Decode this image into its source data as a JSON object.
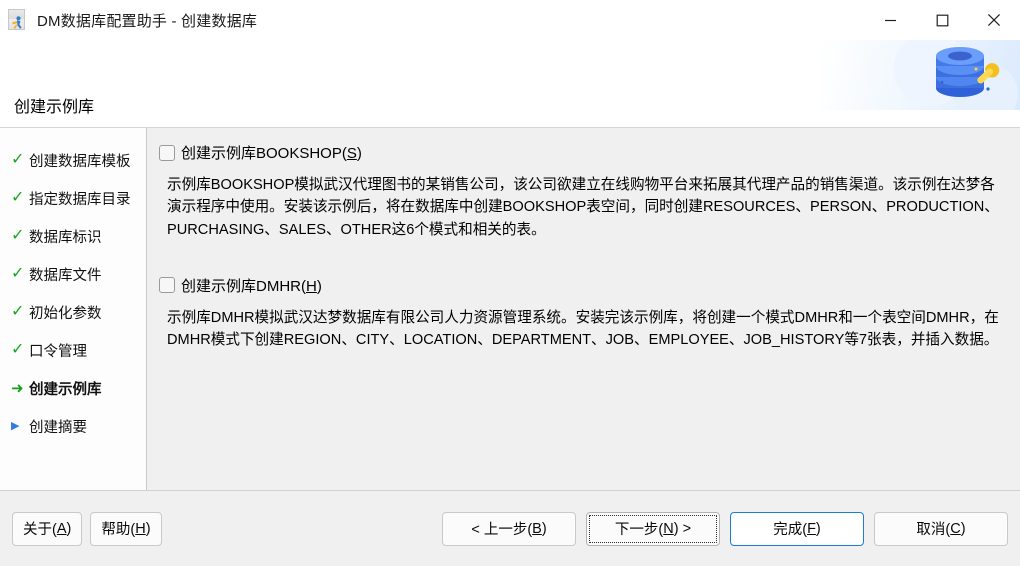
{
  "window": {
    "title": "DM数据库配置助手 - 创建数据库",
    "app_icon": "dm-assistant-icon",
    "controls": {
      "minimize": "minimize-icon",
      "maximize": "maximize-icon",
      "close": "close-icon"
    }
  },
  "banner": {
    "title": "创建示例库",
    "art": "database-wrench-illustration"
  },
  "sidebar": {
    "steps": [
      {
        "label": "创建数据库模板",
        "state": "done",
        "marker": "✓"
      },
      {
        "label": "指定数据库目录",
        "state": "done",
        "marker": "✓"
      },
      {
        "label": "数据库标识",
        "state": "done",
        "marker": "✓"
      },
      {
        "label": "数据库文件",
        "state": "done",
        "marker": "✓"
      },
      {
        "label": "初始化参数",
        "state": "done",
        "marker": "✓"
      },
      {
        "label": "口令管理",
        "state": "done",
        "marker": "✓"
      },
      {
        "label": "创建示例库",
        "state": "current",
        "marker": "➜"
      },
      {
        "label": "创建摘要",
        "state": "todo",
        "marker": "▶"
      }
    ]
  },
  "content": {
    "options": [
      {
        "label_prefix": "创建示例库BOOKSHOP(",
        "mnemonic": "S",
        "label_suffix": ")",
        "checked": false,
        "description": "示例库BOOKSHOP模拟武汉代理图书的某销售公司，该公司欲建立在线购物平台来拓展其代理产品的销售渠道。该示例在达梦各演示程序中使用。安装该示例后，将在数据库中创建BOOKSHOP表空间，同时创建RESOURCES、PERSON、PRODUCTION、PURCHASING、SALES、OTHER这6个模式和相关的表。"
      },
      {
        "label_prefix": "创建示例库DMHR(",
        "mnemonic": "H",
        "label_suffix": ")",
        "checked": false,
        "description": "示例库DMHR模拟武汉达梦数据库有限公司人力资源管理系统。安装完该示例库，将创建一个模式DMHR和一个表空间DMHR，在DMHR模式下创建REGION、CITY、LOCATION、DEPARTMENT、JOB、EMPLOYEE、JOB_HISTORY等7张表，并插入数据。"
      }
    ]
  },
  "footer": {
    "about": {
      "prefix": "关于(",
      "mnemonic": "A",
      "suffix": ")"
    },
    "help": {
      "prefix": "帮助(",
      "mnemonic": "H",
      "suffix": ")"
    },
    "prev": {
      "prefix": "< 上一步(",
      "mnemonic": "B",
      "suffix": ")"
    },
    "next": {
      "prefix": "下一步(",
      "mnemonic": "N",
      "suffix": ") >"
    },
    "finish": {
      "prefix": "完成(",
      "mnemonic": "F",
      "suffix": ")"
    },
    "cancel": {
      "prefix": "取消(",
      "mnemonic": "C",
      "suffix": ")"
    }
  },
  "colors": {
    "done_check": "#18a81c",
    "current_arrow": "#12a014",
    "todo_triangle": "#2f7fe0",
    "default_button_border": "#1a7fd4",
    "content_bg": "#f0f0f0"
  }
}
